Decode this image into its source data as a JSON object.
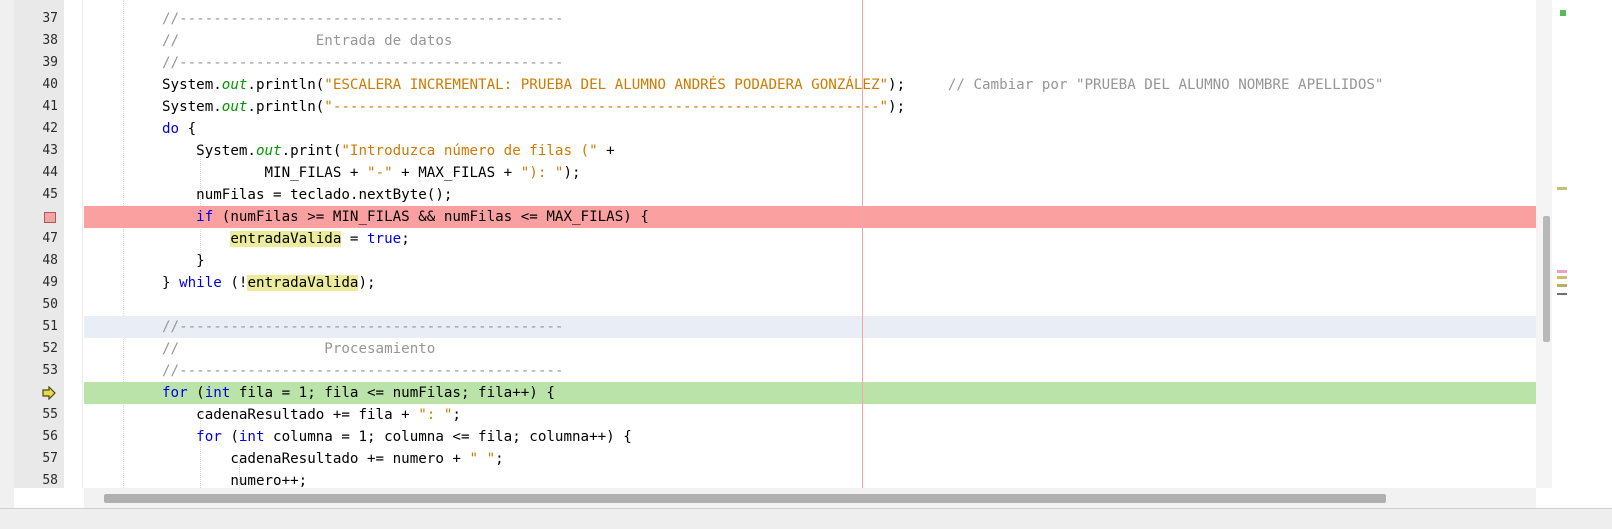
{
  "editor": {
    "lines": [
      {
        "num": "37",
        "segments": [
          {
            "c": "com",
            "t": "//---------------------------------------------"
          }
        ]
      },
      {
        "num": "38",
        "segments": [
          {
            "c": "com",
            "t": "//                Entrada de datos"
          }
        ]
      },
      {
        "num": "39",
        "segments": [
          {
            "c": "com",
            "t": "//---------------------------------------------"
          }
        ]
      },
      {
        "num": "40",
        "segments": [
          {
            "c": "",
            "t": "System."
          },
          {
            "c": "fld",
            "t": "out"
          },
          {
            "c": "",
            "t": ".println("
          },
          {
            "c": "str",
            "t": "\"ESCALERA INCREMENTAL: PRUEBA DEL ALUMNO ANDRÉS PODADERA GONZÁLEZ\""
          },
          {
            "c": "",
            "t": ");     "
          },
          {
            "c": "com",
            "t": "// Cambiar por \"PRUEBA DEL ALUMNO NOMBRE APELLIDOS\""
          }
        ]
      },
      {
        "num": "41",
        "segments": [
          {
            "c": "",
            "t": "System."
          },
          {
            "c": "fld",
            "t": "out"
          },
          {
            "c": "",
            "t": ".println("
          },
          {
            "c": "str",
            "t": "\"----------------------------------------------------------------\""
          },
          {
            "c": "",
            "t": ");"
          }
        ]
      },
      {
        "num": "42",
        "segments": [
          {
            "c": "kw",
            "t": "do"
          },
          {
            "c": "",
            "t": " {"
          }
        ]
      },
      {
        "num": "43",
        "segments": [
          {
            "c": "",
            "t": "    System."
          },
          {
            "c": "fld",
            "t": "out"
          },
          {
            "c": "",
            "t": ".print("
          },
          {
            "c": "str",
            "t": "\"Introduzca número de filas (\""
          },
          {
            "c": "",
            "t": " +"
          }
        ]
      },
      {
        "num": "44",
        "segments": [
          {
            "c": "",
            "t": "            MIN_FILAS + "
          },
          {
            "c": "str",
            "t": "\"-\""
          },
          {
            "c": "",
            "t": " + MAX_FILAS + "
          },
          {
            "c": "str",
            "t": "\"): \""
          },
          {
            "c": "",
            "t": ");"
          }
        ]
      },
      {
        "num": "45",
        "segments": [
          {
            "c": "",
            "t": "    numFilas = teclado.nextByte();"
          }
        ]
      },
      {
        "num": "46",
        "segments": [
          {
            "c": "",
            "t": "    "
          },
          {
            "c": "kw",
            "t": "if"
          },
          {
            "c": "",
            "t": " (numFilas >= MIN_FILAS && numFilas <= MAX_FILAS) {"
          }
        ]
      },
      {
        "num": "47",
        "segments": [
          {
            "c": "",
            "t": "        "
          },
          {
            "c": "occ",
            "t": "entradaValida"
          },
          {
            "c": "",
            "t": " = "
          },
          {
            "c": "kw",
            "t": "true"
          },
          {
            "c": "",
            "t": ";"
          }
        ]
      },
      {
        "num": "48",
        "segments": [
          {
            "c": "",
            "t": "    }"
          }
        ]
      },
      {
        "num": "49",
        "segments": [
          {
            "c": "",
            "t": "} "
          },
          {
            "c": "kw",
            "t": "while"
          },
          {
            "c": "",
            "t": " (!"
          },
          {
            "c": "occ",
            "t": "entradaValida"
          },
          {
            "c": "",
            "t": ");"
          }
        ]
      },
      {
        "num": "50",
        "segments": []
      },
      {
        "num": "51",
        "segments": [
          {
            "c": "com",
            "t": "//---------------------------------------------"
          }
        ]
      },
      {
        "num": "52",
        "segments": [
          {
            "c": "com",
            "t": "//                 Procesamiento"
          }
        ]
      },
      {
        "num": "53",
        "segments": [
          {
            "c": "com",
            "t": "//---------------------------------------------"
          }
        ]
      },
      {
        "num": "54",
        "segments": [
          {
            "c": "kw",
            "t": "for"
          },
          {
            "c": "",
            "t": " ("
          },
          {
            "c": "kw",
            "t": "int"
          },
          {
            "c": "",
            "t": " fila = 1; fila <= numFilas; fila++) {"
          }
        ]
      },
      {
        "num": "55",
        "segments": [
          {
            "c": "",
            "t": "    cadenaResultado += fila + "
          },
          {
            "c": "str",
            "t": "\": \""
          },
          {
            "c": "",
            "t": ";"
          }
        ]
      },
      {
        "num": "56",
        "segments": [
          {
            "c": "",
            "t": "    "
          },
          {
            "c": "kw",
            "t": "for"
          },
          {
            "c": "",
            "t": " ("
          },
          {
            "c": "kw",
            "t": "int"
          },
          {
            "c": "",
            "t": " columna = 1; columna <= fila; columna++) {"
          }
        ]
      },
      {
        "num": "57",
        "segments": [
          {
            "c": "",
            "t": "        cadenaResultado += numero + "
          },
          {
            "c": "str",
            "t": "\" \""
          },
          {
            "c": "",
            "t": ";"
          }
        ]
      },
      {
        "num": "58",
        "segments": [
          {
            "c": "",
            "t": "        numero++;"
          }
        ]
      }
    ],
    "breakpoint_line": "46",
    "current_line": "54",
    "caret_line": "51",
    "colors": {
      "keyword": "#0000e6",
      "string": "#ce7b00",
      "comment": "#969696",
      "static_field": "#009900",
      "breakpoint_bg": "#fba0a0",
      "execution_bg": "#b9e3a9",
      "occurrence_bg": "#ecec9c"
    },
    "icons": {
      "breakpoint": "breakpoint-icon",
      "program_counter": "program-counter-arrow-icon"
    }
  }
}
